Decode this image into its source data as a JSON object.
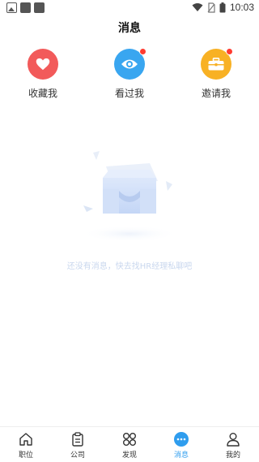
{
  "status_bar": {
    "time": "10:03",
    "icons": [
      "image-icon",
      "notification-icon",
      "notification-icon",
      "wifi-icon",
      "no-sim-icon",
      "battery-icon"
    ]
  },
  "header": {
    "title": "消息"
  },
  "quick_entries": [
    {
      "label": "收藏我",
      "icon": "heart-icon",
      "color": "#f25a5a",
      "badge": false
    },
    {
      "label": "看过我",
      "icon": "eye-icon",
      "color": "#39a6f0",
      "badge": true
    },
    {
      "label": "邀请我",
      "icon": "briefcase-icon",
      "color": "#f8b124",
      "badge": true
    }
  ],
  "empty_state": {
    "icon": "empty-inbox-icon",
    "message": "还没有消息，快去找HR经理私聊吧"
  },
  "tabbar": {
    "active_color": "#2f9dee",
    "items": [
      {
        "label": "职位",
        "icon": "home-icon",
        "active": false
      },
      {
        "label": "公司",
        "icon": "clipboard-icon",
        "active": false
      },
      {
        "label": "发现",
        "icon": "discover-icon",
        "active": false
      },
      {
        "label": "消息",
        "icon": "message-icon",
        "active": true
      },
      {
        "label": "我的",
        "icon": "profile-icon",
        "active": false
      }
    ]
  }
}
